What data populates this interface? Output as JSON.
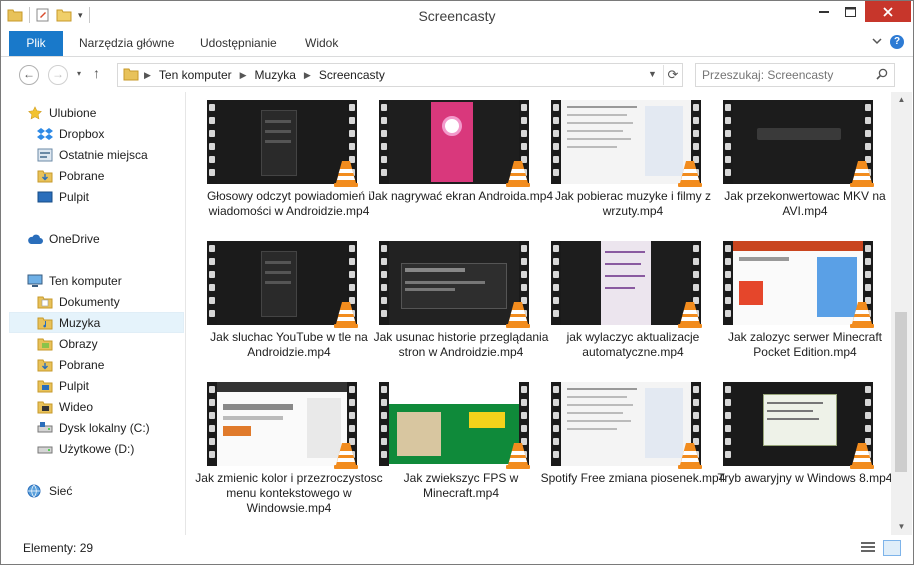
{
  "window": {
    "title": "Screencasty"
  },
  "ribbon": {
    "tabs": [
      "Plik",
      "Narzędzia główne",
      "Udostępnianie",
      "Widok"
    ],
    "help_label": "?"
  },
  "address": {
    "crumbs": [
      "Ten komputer",
      "Muzyka",
      "Screencasty"
    ]
  },
  "search": {
    "placeholder": "Przeszukaj: Screencasty"
  },
  "navpane": {
    "favorites_header": "Ulubione",
    "favorites": [
      "Dropbox",
      "Ostatnie miejsca",
      "Pobrane",
      "Pulpit"
    ],
    "onedrive": "OneDrive",
    "computer_header": "Ten komputer",
    "computer": [
      "Dokumenty",
      "Muzyka",
      "Obrazy",
      "Pobrane",
      "Pulpit",
      "Wideo",
      "Dysk lokalny (C:)",
      "Użytkowe (D:)"
    ],
    "network": "Sieć",
    "selected": "Muzyka"
  },
  "files": [
    {
      "name": "Głosowy odczyt powiadomień i wiadomości w Androidzie.mp4",
      "thumb": "dark-phone"
    },
    {
      "name": "Jak nagrywać ekran Androida.mp4",
      "thumb": "pink-app"
    },
    {
      "name": "Jak pobierac muzyke i filmy z wrzuty.mp4",
      "thumb": "web-page"
    },
    {
      "name": "Jak przekonwertowac MKV na AVI.mp4",
      "thumb": "dark-logo"
    },
    {
      "name": "Jak sluchac YouTube w tle na Androidzie.mp4",
      "thumb": "dark-phone"
    },
    {
      "name": "Jak usunac historie przeglądania stron w Androidzie.mp4",
      "thumb": "dialog"
    },
    {
      "name": "jak wylaczyc aktualizacje automatyczne.mp4",
      "thumb": "settings"
    },
    {
      "name": "Jak zalozyc serwer Minecraft Pocket Edition.mp4",
      "thumb": "web-shop"
    },
    {
      "name": "Jak zmienic kolor i przezroczystosc menu kontekstowego w Windowsie.mp4",
      "thumb": "web-form"
    },
    {
      "name": "Jak zwiekszyc FPS w Minecraft.mp4",
      "thumb": "web-green"
    },
    {
      "name": "Spotify Free zmiana piosenek.mp4",
      "thumb": "web-page"
    },
    {
      "name": "Tryb awaryjny w Windows 8.mp4",
      "thumb": "window-dialog"
    }
  ],
  "status": {
    "count_label": "Elementy: 29"
  },
  "colors": {
    "accent": "#1979ca",
    "close": "#c7362b",
    "selection": "#e5f3fb",
    "vlc_orange": "#f28c1e"
  }
}
